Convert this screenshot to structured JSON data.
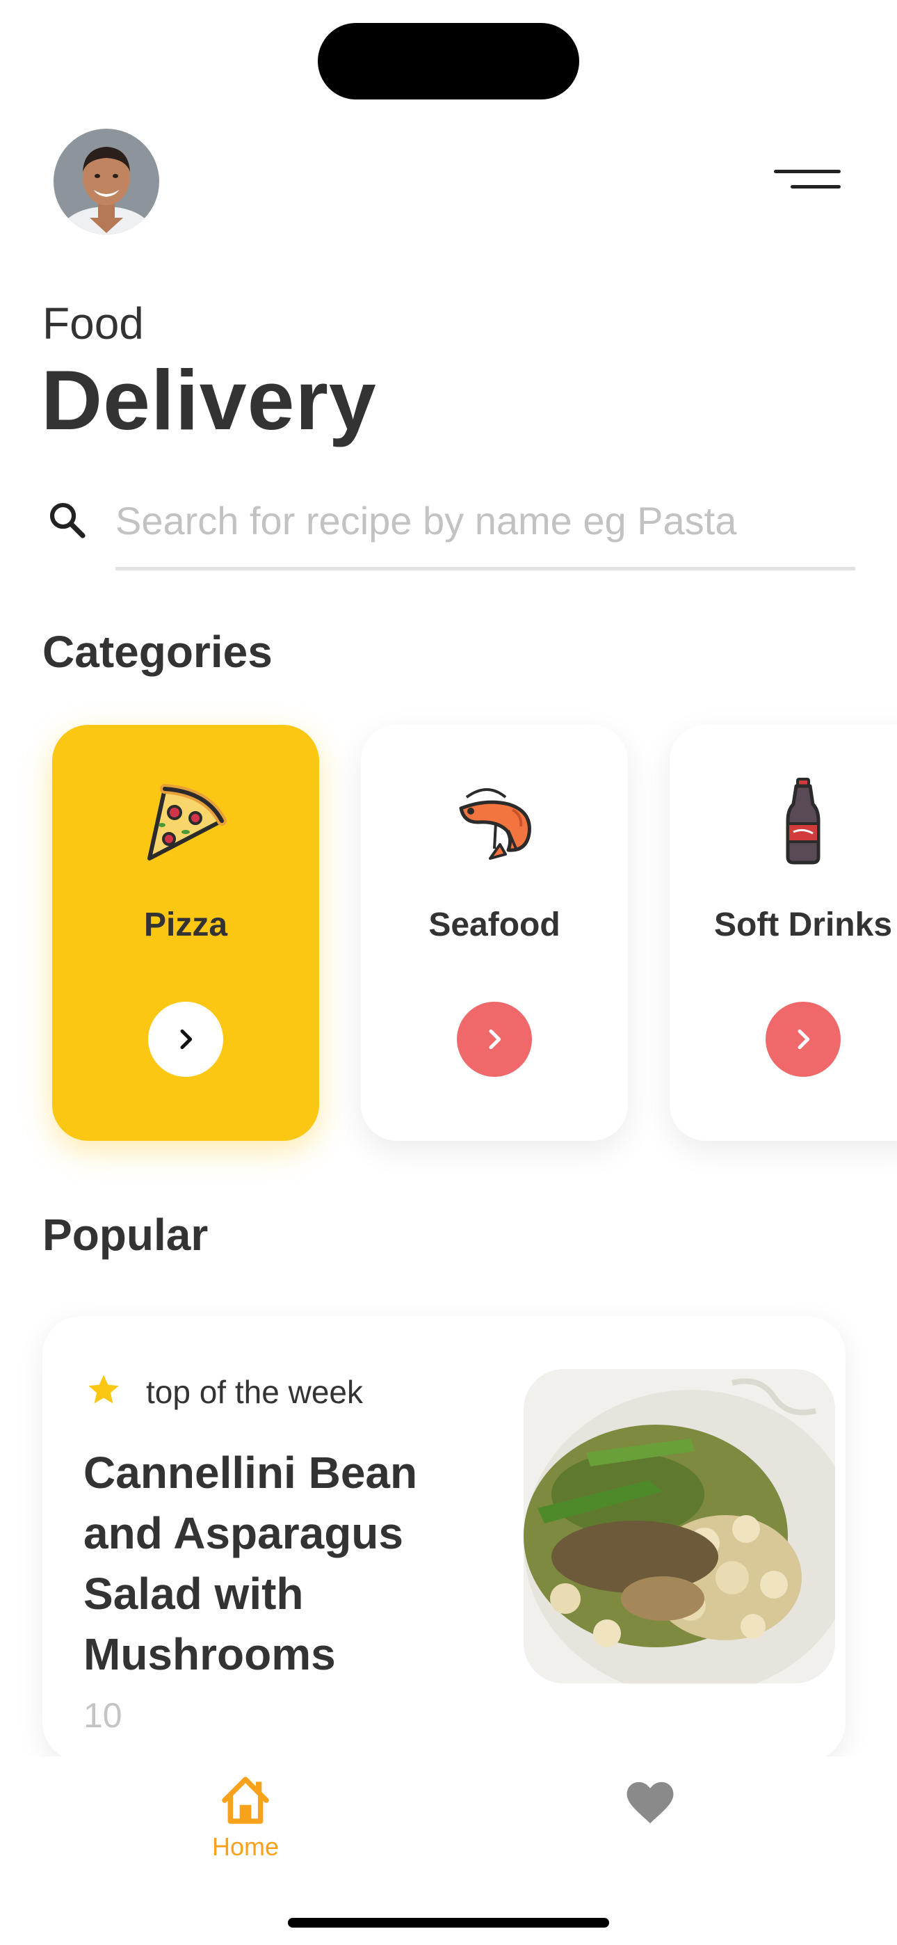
{
  "header": {
    "avatar_icon": "user-avatar-photo",
    "menu_icon": "menu-lines-icon",
    "title_small": "Food",
    "title_big": "Delivery"
  },
  "search": {
    "icon": "search-icon",
    "placeholder": "Search for recipe by name eg Pasta",
    "value": ""
  },
  "categories": {
    "title": "Categories",
    "items": [
      {
        "label": "Pizza",
        "icon": "pizza-icon",
        "active": true
      },
      {
        "label": "Seafood",
        "icon": "shrimp-icon",
        "active": false
      },
      {
        "label": "Soft Drinks",
        "icon": "soda-bottle-icon",
        "active": false
      }
    ]
  },
  "popular": {
    "title": "Popular",
    "card": {
      "badge_icon": "star-icon",
      "badge": "top of the week",
      "title": "Cannellini Bean and Asparagus Salad with Mushrooms",
      "count": "10",
      "image": "salad-photo"
    }
  },
  "bottom_nav": {
    "items": [
      {
        "label": "Home",
        "icon": "home-icon",
        "active": true
      },
      {
        "label": "",
        "icon": "heart-icon",
        "active": false
      }
    ]
  },
  "colors": {
    "accent_yellow": "#fcc713",
    "accent_red": "#f0696a",
    "nav_active": "#f8a21c",
    "nav_inactive": "#8a8a8a",
    "text": "#333333",
    "muted": "#c4c4c4"
  }
}
